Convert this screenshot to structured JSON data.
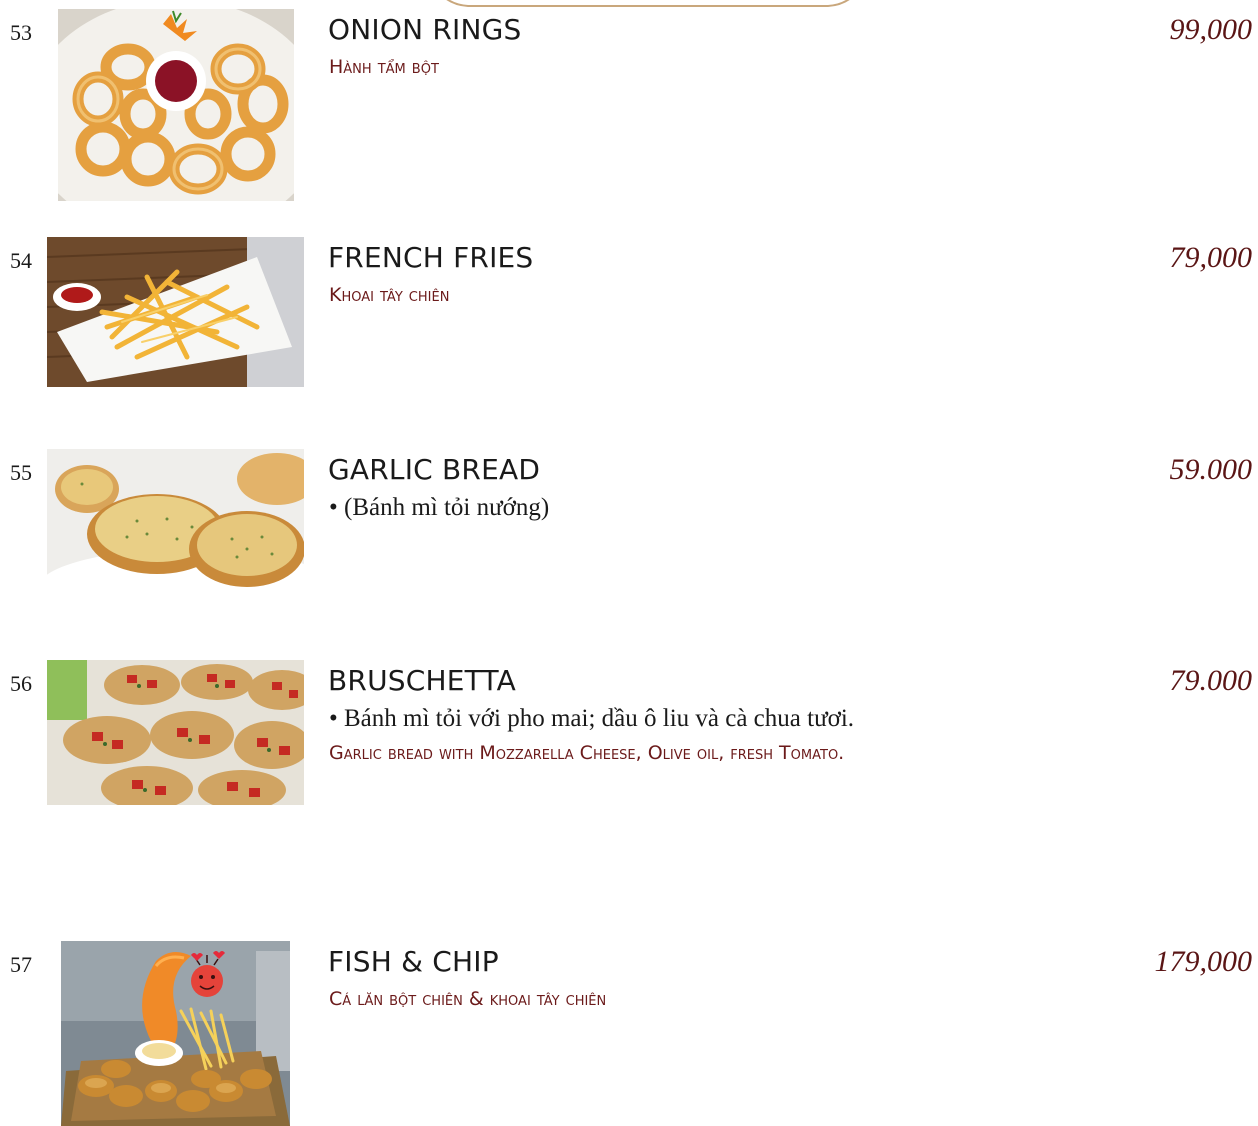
{
  "items": [
    {
      "number": "53",
      "name": "ONION RINGS",
      "subtitle": "Hành tẩm bột",
      "price": "99,000",
      "image_icon": "onion-rings-photo"
    },
    {
      "number": "54",
      "name": "FRENCH FRIES",
      "subtitle": "Khoai tây chiên",
      "price": "79,000",
      "image_icon": "french-fries-photo"
    },
    {
      "number": "55",
      "name": "GARLIC BREAD",
      "description_vi": "• (Bánh mì tỏi nướng)",
      "price": "59.000",
      "image_icon": "garlic-bread-photo"
    },
    {
      "number": "56",
      "name": "BRUSCHETTA",
      "description_vi": "• Bánh mì tỏi với pho mai; dầu ô liu và cà chua tươi.",
      "subtitle": "Garlic bread with Mozzarella Cheese, Olive oil, fresh Tomato.",
      "price": "79.000",
      "image_icon": "bruschetta-photo"
    },
    {
      "number": "57",
      "name": "FISH & CHIP",
      "subtitle": "Cá lăn bột chiên & khoai tây chiên",
      "price": "179,000",
      "image_icon": "fish-and-chips-photo"
    }
  ],
  "colors": {
    "subtitle": "#6b1a1a",
    "price": "#5a1515",
    "ornament": "#c9a77c"
  }
}
